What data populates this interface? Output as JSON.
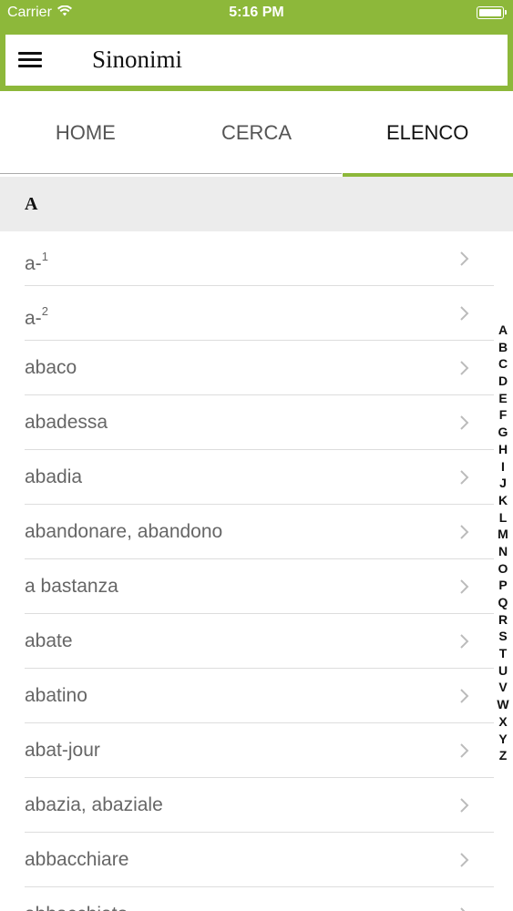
{
  "status_bar": {
    "carrier": "Carrier",
    "time": "5:16 PM",
    "wifi_icon": "wifi-icon",
    "battery_icon": "battery-icon"
  },
  "header": {
    "title": "Sinonimi",
    "menu_icon": "hamburger-menu-icon",
    "accent_color": "#8db83a"
  },
  "tabs": [
    {
      "label": "HOME",
      "active": false
    },
    {
      "label": "CERCA",
      "active": false
    },
    {
      "label": "ELENCO",
      "active": true
    }
  ],
  "section": {
    "letter": "A"
  },
  "list": {
    "chevron_icon": "chevron-right-icon",
    "items": [
      {
        "label": "a-",
        "sup": "1"
      },
      {
        "label": "a-",
        "sup": "2"
      },
      {
        "label": "abaco",
        "sup": ""
      },
      {
        "label": "abadessa",
        "sup": ""
      },
      {
        "label": "abadia",
        "sup": ""
      },
      {
        "label": "abandonare, abandono",
        "sup": ""
      },
      {
        "label": "a bastanza",
        "sup": ""
      },
      {
        "label": "abate",
        "sup": ""
      },
      {
        "label": "abatino",
        "sup": ""
      },
      {
        "label": "abat-jour",
        "sup": ""
      },
      {
        "label": "abazia, abaziale",
        "sup": ""
      },
      {
        "label": "abbacchiare",
        "sup": ""
      },
      {
        "label": "abbacchiato",
        "sup": ""
      }
    ]
  },
  "alphabet_index": [
    "A",
    "B",
    "C",
    "D",
    "E",
    "F",
    "G",
    "H",
    "I",
    "J",
    "K",
    "L",
    "M",
    "N",
    "O",
    "P",
    "Q",
    "R",
    "S",
    "T",
    "U",
    "V",
    "W",
    "X",
    "Y",
    "Z"
  ]
}
